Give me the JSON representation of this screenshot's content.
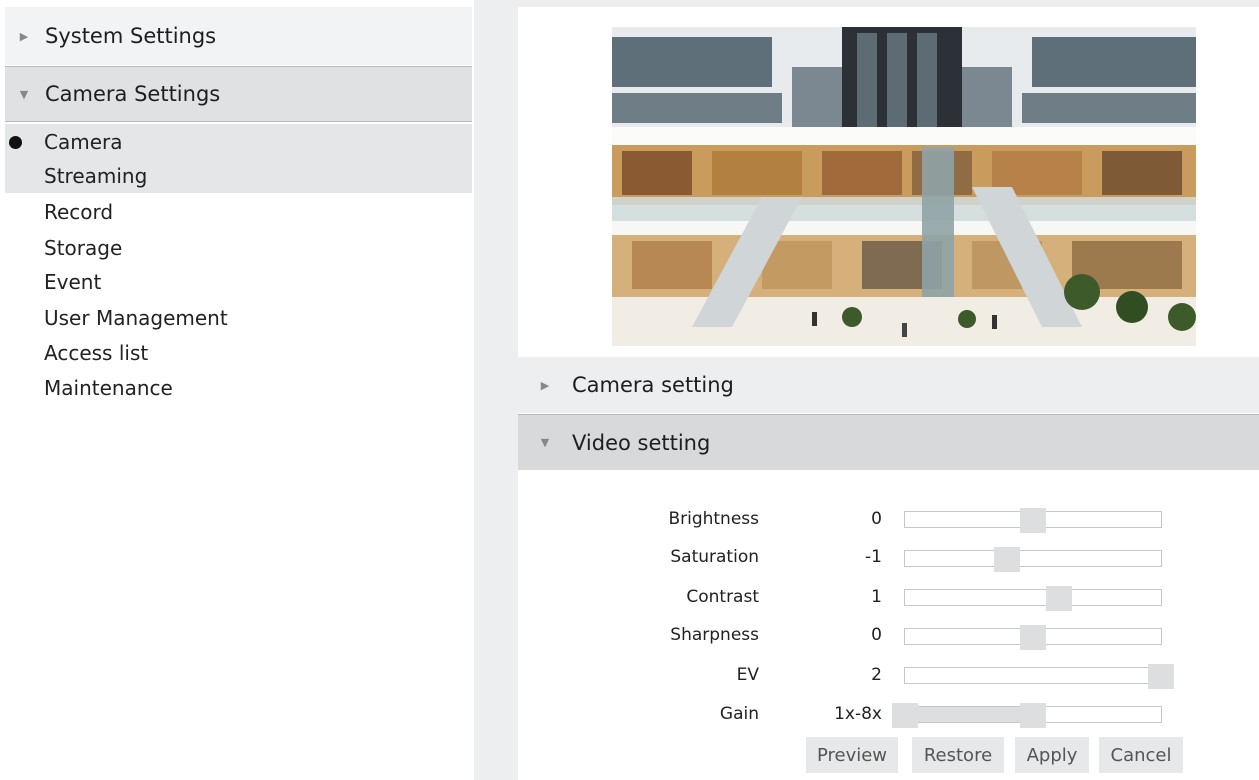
{
  "sidebar": {
    "system_settings": "System Settings",
    "camera_settings": "Camera Settings",
    "items": [
      "Camera",
      "Streaming",
      "Record",
      "Storage",
      "Event",
      "User Management",
      "Access list",
      "Maintenance"
    ],
    "active_item": "Camera"
  },
  "main": {
    "accordion": {
      "camera_setting": "Camera setting",
      "video_setting": "Video setting"
    },
    "video": {
      "rows": [
        {
          "label": "Brightness",
          "value": "0",
          "position": 0.5
        },
        {
          "label": "Saturation",
          "value": "-1",
          "position": 0.4
        },
        {
          "label": "Contrast",
          "value": "1",
          "position": 0.6
        },
        {
          "label": "Sharpness",
          "value": "0",
          "position": 0.5
        },
        {
          "label": "EV",
          "value": "2",
          "position": 1.0
        },
        {
          "label": "Gain",
          "value": "1x-8x",
          "range": [
            0.0,
            0.5
          ]
        }
      ]
    },
    "buttons": {
      "preview": "Preview",
      "restore": "Restore",
      "apply": "Apply",
      "cancel": "Cancel"
    }
  },
  "colors": {
    "panel_bg": "#eceeef",
    "header_active": "#d7d9db",
    "slider_thumb": "#dcdedf"
  },
  "icons": [
    "collapsed-arrow-icon",
    "expanded-arrow-icon",
    "active-bullet-icon"
  ]
}
